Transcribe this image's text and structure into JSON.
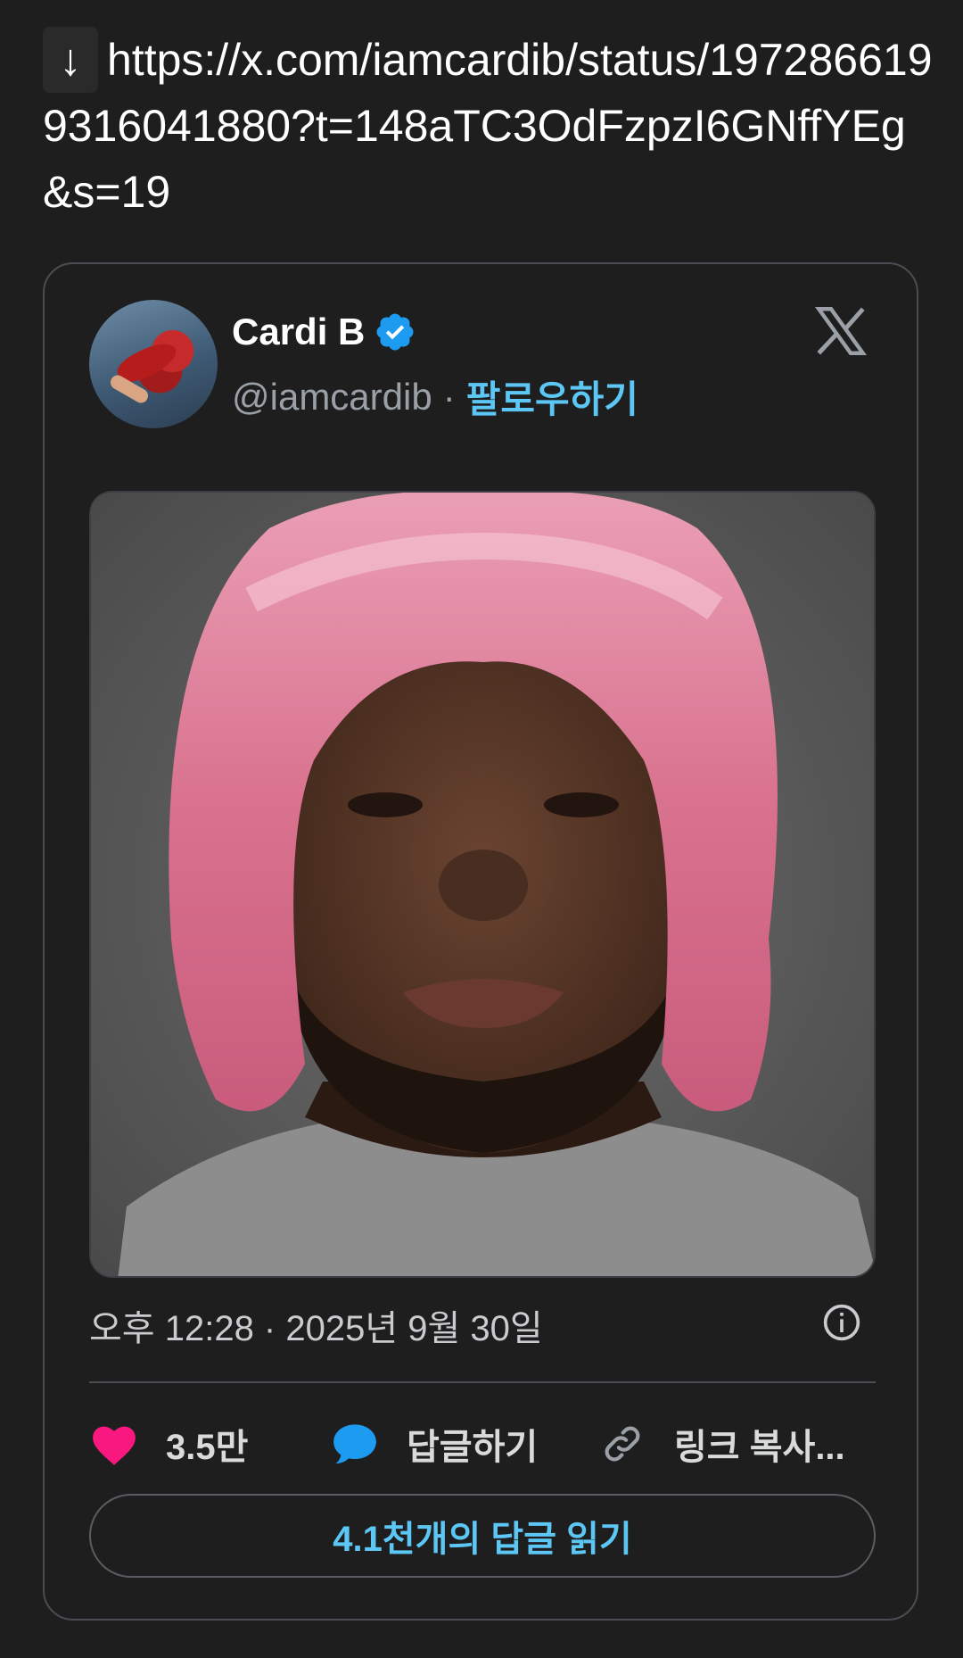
{
  "url": {
    "arrow": "↓",
    "text": "https://x.com/iamcardib/status/1972866199316041880?t=148aTC3OdFzpzI6GNffYEg&s=19"
  },
  "tweet": {
    "author_name": "Cardi B",
    "verified": true,
    "handle": "@iamcardib",
    "separator": "·",
    "follow_label": "팔로우하기",
    "timestamp": "오후 12:28 · 2025년 9월 30일",
    "likes": "3.5만",
    "reply_label": "답글하기",
    "copy_link_label": "링크 복사...",
    "read_replies_label": "4.1천개의 답글 읽기"
  },
  "colors": {
    "background": "#1e1e1e",
    "accent": "#5cc6f4",
    "like": "#f91880",
    "reply": "#1d9bf0",
    "verified": "#1d9bf0"
  },
  "icons": {
    "download": "download-arrow-icon",
    "verified": "verified-badge-icon",
    "brand": "x-logo-icon",
    "info": "info-icon",
    "like": "heart-icon",
    "reply": "speech-bubble-icon",
    "link": "link-icon"
  }
}
